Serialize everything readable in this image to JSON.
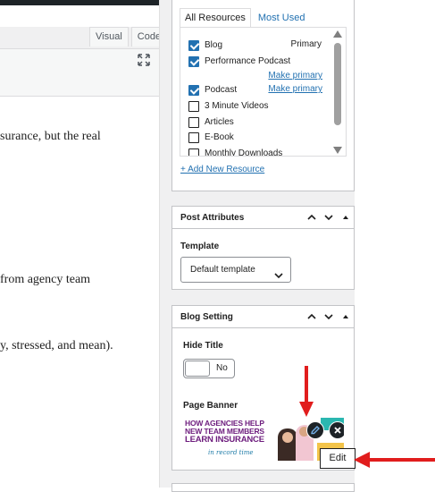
{
  "editor": {
    "tabs": [
      "Visual",
      "Code"
    ],
    "content_lines": [
      "surance, but the real",
      "from agency team",
      "y, stressed, and mean)."
    ]
  },
  "resources": {
    "tabs": [
      "All Resources",
      "Most Used"
    ],
    "items": [
      {
        "label": "Blog",
        "checked": true,
        "primary_text": "Primary",
        "make_primary": ""
      },
      {
        "label": "Performance Podcast",
        "checked": true,
        "primary_text": "",
        "make_primary": "Make primary"
      },
      {
        "label": "Podcast",
        "checked": true,
        "primary_text": "",
        "make_primary": "Make primary"
      },
      {
        "label": "3 Minute Videos",
        "checked": false,
        "primary_text": "",
        "make_primary": ""
      },
      {
        "label": "Articles",
        "checked": false,
        "primary_text": "",
        "make_primary": ""
      },
      {
        "label": "E-Book",
        "checked": false,
        "primary_text": "",
        "make_primary": ""
      },
      {
        "label": "Monthly Downloads",
        "checked": false,
        "primary_text": "",
        "make_primary": ""
      }
    ],
    "add_new": "+ Add New Resource"
  },
  "post_attributes": {
    "title": "Post Attributes",
    "template_label": "Template",
    "template_value": "Default template"
  },
  "blog_setting": {
    "title": "Blog Setting",
    "hide_title_label": "Hide Title",
    "toggle_value": "No",
    "page_banner_label": "Page Banner",
    "banner_lines": [
      "HOW AGENCIES HELP",
      "NEW TEAM MEMBERS",
      "LEARN INSURANCE"
    ],
    "banner_script": "in record time"
  },
  "tooltip": {
    "edit": "Edit"
  },
  "colors": {
    "accent": "#2271b1",
    "annotation_arrow": "#e11d1d"
  }
}
